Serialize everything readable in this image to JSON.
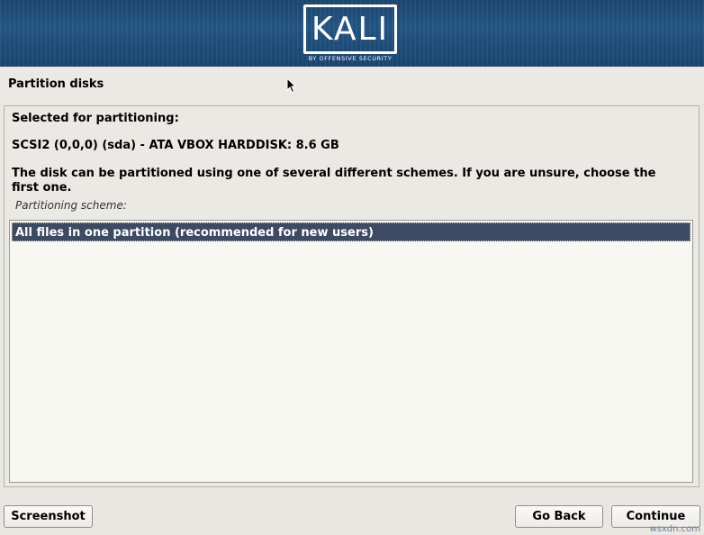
{
  "banner": {
    "logo_text": "KALI",
    "logo_subtitle": "BY OFFENSIVE SECURITY"
  },
  "page": {
    "title": "Partition disks"
  },
  "content": {
    "selected_label": "Selected for partitioning:",
    "disk_name": "SCSI2 (0,0,0) (sda) - ATA VBOX HARDDISK: 8.6 GB",
    "description": "The disk can be partitioned using one of several different schemes. If you are unsure, choose the first one.",
    "scheme_label": "Partitioning scheme:",
    "options": [
      {
        "label": "All files in one partition (recommended for new users)",
        "selected": true
      }
    ]
  },
  "buttons": {
    "screenshot": "Screenshot",
    "go_back": "Go Back",
    "continue": "Continue"
  },
  "watermark": "wsxdn.com",
  "colors": {
    "banner": "#235686",
    "selection": "#3c4a63",
    "background": "#ebe9e4"
  }
}
